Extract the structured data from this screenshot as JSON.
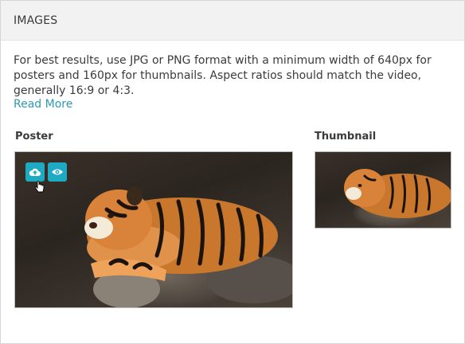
{
  "section": {
    "title": "IMAGES"
  },
  "description": {
    "text": "For best results, use JPG or PNG format with a minimum width of 640px for posters and 160px for thumbnails. Aspect ratios should match the video, generally 16:9 or 4:3.",
    "read_more_label": "Read More"
  },
  "poster": {
    "label": "Poster",
    "image_subject": "tiger",
    "actions": [
      {
        "name": "upload",
        "icon": "cloud-upload-icon"
      },
      {
        "name": "preview",
        "icon": "eye-icon"
      }
    ]
  },
  "thumbnail": {
    "label": "Thumbnail",
    "image_subject": "tiger"
  },
  "colors": {
    "accent": "#1faac4",
    "link": "#2a9bb0",
    "header_bg": "#f2f2f2"
  }
}
